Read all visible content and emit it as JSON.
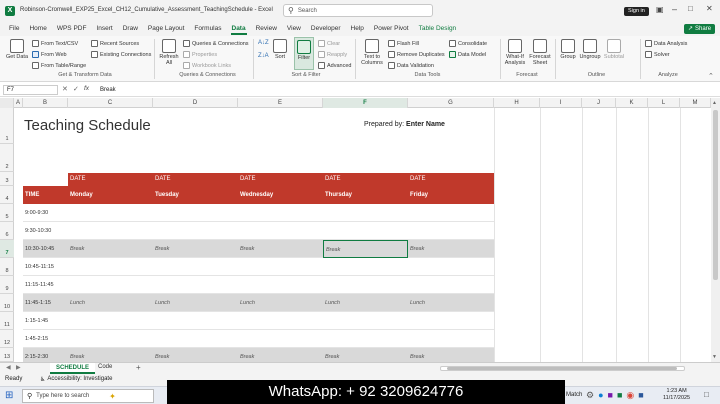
{
  "title": {
    "filename": "Robinson-Cromwell_EXP25_Excel_CH12_Cumulative_Assessment_TeachingSchedule - Excel",
    "search_placeholder": "Search",
    "signin": "Sign in"
  },
  "menu": [
    "File",
    "Home",
    "WPS PDF",
    "Insert",
    "Draw",
    "Page Layout",
    "Formulas",
    "Data",
    "Review",
    "View",
    "Developer",
    "Help",
    "Power Pivot",
    "Table Design"
  ],
  "share_label": "Share",
  "ribbon": {
    "get_data": "Get Data",
    "from_text_csv": "From Text/CSV",
    "from_web": "From Web",
    "from_table_range": "From Table/Range",
    "recent_sources": "Recent Sources",
    "existing_connections": "Existing Connections",
    "group_get_transform": "Get & Transform Data",
    "refresh_all": "Refresh All",
    "queries_connections": "Queries & Connections",
    "properties": "Properties",
    "workbook_links": "Workbook Links",
    "group_queries": "Queries & Connections",
    "sort": "Sort",
    "filter": "Filter",
    "clear": "Clear",
    "reapply": "Reapply",
    "advanced": "Advanced",
    "group_sort_filter": "Sort & Filter",
    "text_to_columns": "Text to Columns",
    "flash_fill": "Flash Fill",
    "remove_duplicates": "Remove Duplicates",
    "data_validation": "Data Validation",
    "consolidate": "Consolidate",
    "data_model": "Data Model",
    "group_data_tools": "Data Tools",
    "what_if": "What-If Analysis",
    "forecast_sheet": "Forecast Sheet",
    "group_forecast": "Forecast",
    "group_btn": "Group",
    "ungroup": "Ungroup",
    "subtotal": "Subtotal",
    "group_outline": "Outline",
    "data_analysis": "Data Analysis",
    "solver": "Solver",
    "group_analyze": "Analyze"
  },
  "formula": {
    "name_box": "F7",
    "fx": "fx",
    "value": "Break"
  },
  "columns": [
    "A",
    "B",
    "C",
    "D",
    "E",
    "F",
    "G",
    "H",
    "I",
    "J",
    "K",
    "L",
    "M",
    "N"
  ],
  "rows": [
    "1",
    "2",
    "3",
    "4",
    "5",
    "6",
    "7",
    "8",
    "9",
    "10",
    "11",
    "12",
    "13"
  ],
  "sheet": {
    "title": "Teaching Schedule",
    "prepared_label": "Prepared by:",
    "prepared_value": "Enter Name",
    "date_labels": [
      "DATE",
      "DATE",
      "DATE",
      "DATE",
      "DATE"
    ],
    "header": [
      "TIME",
      "Monday",
      "Tuesday",
      "Wednesday",
      "Thursday",
      "Friday"
    ],
    "rows": [
      {
        "time": "9:00-9:30",
        "cells": [
          "",
          "",
          "",
          "",
          ""
        ],
        "shaded": false
      },
      {
        "time": "9:30-10:30",
        "cells": [
          "",
          "",
          "",
          "",
          ""
        ],
        "shaded": false
      },
      {
        "time": "10:30-10:45",
        "cells": [
          "Break",
          "Break",
          "Break",
          "Break",
          "Break"
        ],
        "shaded": true
      },
      {
        "time": "10:45-11:15",
        "cells": [
          "",
          "",
          "",
          "",
          ""
        ],
        "shaded": false
      },
      {
        "time": "11:15-11:45",
        "cells": [
          "",
          "",
          "",
          "",
          ""
        ],
        "shaded": false
      },
      {
        "time": "11:45-1:15",
        "cells": [
          "Lunch",
          "Lunch",
          "Lunch",
          "Lunch",
          "Lunch"
        ],
        "shaded": true
      },
      {
        "time": "1:15-1:45",
        "cells": [
          "",
          "",
          "",
          "",
          ""
        ],
        "shaded": false
      },
      {
        "time": "1:45-2:15",
        "cells": [
          "",
          "",
          "",
          "",
          ""
        ],
        "shaded": false
      },
      {
        "time": "2:15-2:30",
        "cells": [
          "Break",
          "Break",
          "Break",
          "Break",
          "Break"
        ],
        "shaded": true
      }
    ]
  },
  "sheet_tabs": {
    "active": "SCHEDULE",
    "other": "Code",
    "add": "+"
  },
  "status": {
    "ready": "Ready",
    "accessibility": "Accessibility: Investigate"
  },
  "taskbar": {
    "search_placeholder": "Type here to search",
    "time": "1:23 AM",
    "date": "11/17/2025",
    "match": "Match"
  },
  "overlay_text": "WhatsApp: + 92 3209624776",
  "colors": {
    "header_red": "#c0392b",
    "accent_green": "#107c41",
    "shaded_row": "#d9d9d9"
  }
}
